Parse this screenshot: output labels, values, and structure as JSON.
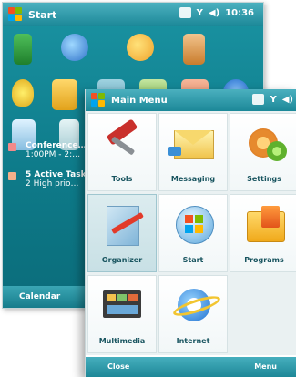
{
  "back_screen": {
    "title": "Start",
    "time": "10:36",
    "list": [
      {
        "line1": "Conference…",
        "line2": "1:00PM - 2:…"
      },
      {
        "line1": "5 Active Tasks",
        "line2": "2 High prio…"
      }
    ],
    "left_softkey": "Calendar"
  },
  "front_screen": {
    "title": "Main Menu",
    "tiles": [
      {
        "label": "Tools",
        "icon": "tools-icon"
      },
      {
        "label": "Messaging",
        "icon": "messaging-icon"
      },
      {
        "label": "Settings",
        "icon": "settings-icon"
      },
      {
        "label": "Organizer",
        "icon": "organizer-icon"
      },
      {
        "label": "Start",
        "icon": "windows-start-icon"
      },
      {
        "label": "Programs",
        "icon": "programs-icon"
      },
      {
        "label": "Multimedia",
        "icon": "multimedia-icon"
      },
      {
        "label": "Internet",
        "icon": "internet-explorer-icon"
      }
    ],
    "left_softkey": "Close",
    "right_softkey": "Menu"
  },
  "colors": {
    "titlebar": "#2a98a8",
    "back_bg": "#0e7b8a",
    "label": "#18545f"
  }
}
